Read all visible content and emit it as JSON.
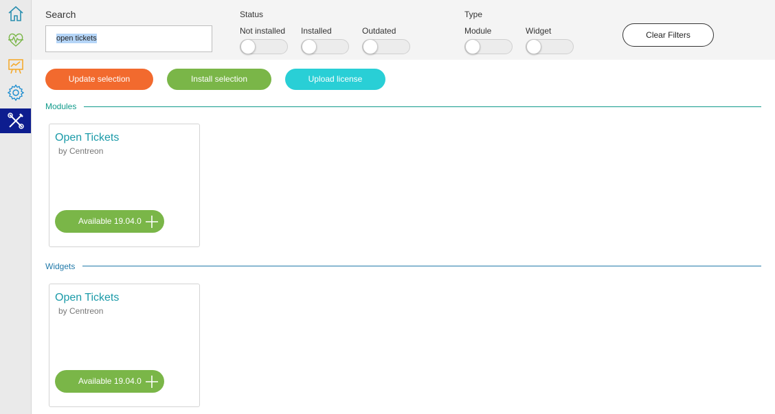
{
  "sidebar": {
    "items": [
      {
        "icon": "home-icon",
        "color": "#2a8fb0"
      },
      {
        "icon": "heartbeat-icon",
        "color": "#7ab648"
      },
      {
        "icon": "chart-board-icon",
        "color": "#f5a623"
      },
      {
        "icon": "gear-icon",
        "color": "#1f8ed0"
      },
      {
        "icon": "tools-icon",
        "color": "#ffffff",
        "active": true
      }
    ]
  },
  "filters": {
    "search": {
      "label": "Search",
      "value": "open tickets"
    },
    "status": {
      "label": "Status",
      "options": [
        {
          "label": "Not installed",
          "on": false
        },
        {
          "label": "Installed",
          "on": false
        },
        {
          "label": "Outdated",
          "on": false
        }
      ]
    },
    "type": {
      "label": "Type",
      "options": [
        {
          "label": "Module",
          "on": false
        },
        {
          "label": "Widget",
          "on": false
        }
      ]
    },
    "clear_label": "Clear Filters"
  },
  "actions": {
    "update_label": "Update selection",
    "install_label": "Install selection",
    "upload_label": "Upload license",
    "colors": {
      "update": "#f26a2e",
      "install": "#7ab648",
      "upload": "#29cfd6"
    }
  },
  "sections": {
    "modules": {
      "title": "Modules",
      "color": "#0f9a8a",
      "cards": [
        {
          "title": "Open Tickets",
          "author": "by Centreon",
          "button": "Available 19.04.0"
        }
      ]
    },
    "widgets": {
      "title": "Widgets",
      "color": "#1f78a8",
      "cards": [
        {
          "title": "Open Tickets",
          "author": "by Centreon",
          "button": "Available 19.04.0"
        }
      ]
    }
  }
}
